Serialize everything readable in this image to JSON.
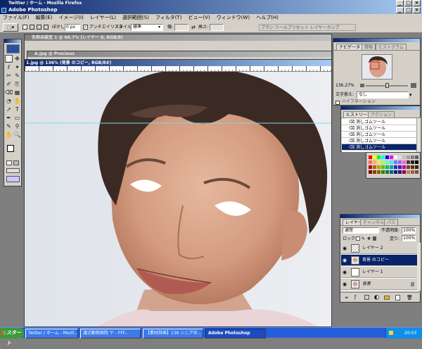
{
  "firefox": {
    "title": "Twitter / ホーム - Mozilla Firefox"
  },
  "photoshop": {
    "title": "Adobe Photoshop",
    "menu": [
      "ファイル(F)",
      "編集(E)",
      "イメージ(I)",
      "レイヤー(L)",
      "選択範囲(S)",
      "フィルタ(T)",
      "ビュー(V)",
      "ウィンドウ(W)",
      "ヘルプ(H)"
    ],
    "options": {
      "feather_label": "ぼかし:",
      "feather_value": "0 px",
      "antialias_label": "アンチエイリアス",
      "style_label": "スタイル:",
      "style_value": "標準",
      "width_label": "幅:",
      "height_label": "高さ:",
      "palette_well": "ブラシ  ツールプリセット  レイヤーカンプ"
    }
  },
  "docs": {
    "back_title": "名称未設定 1 @ 66.7% (レイヤー 0, RGB/8)",
    "mid_title": "A.jpg @ Precious",
    "front_title": "1.jpg @ 136% (背景 のコピー, RGB/8#)"
  },
  "navigator": {
    "tabs": [
      "ナビゲータ",
      "情報",
      "ヒストグラム"
    ],
    "zoom": "136.27%"
  },
  "character": {
    "label": "文字揃え:",
    "value": "なし",
    "checkbox": "ハイフネーション"
  },
  "history": {
    "tabs": [
      "ヒストリー",
      "アクション"
    ],
    "items": [
      "消しゴムツール",
      "消しゴムツール",
      "消しゴムツール",
      "消しゴムツール",
      "消しゴムツール"
    ],
    "selected_index": 4
  },
  "layers": {
    "tabs": [
      "レイヤー",
      "チャンネル",
      "パス"
    ],
    "blend_mode": "通常",
    "opacity_label": "不透明度:",
    "opacity_value": "100%",
    "lock_label": "ロック:",
    "fill_label": "塗り:",
    "fill_value": "100%",
    "rows": [
      {
        "name": "レイヤー 2",
        "selected": false
      },
      {
        "name": "背景 のコピー",
        "selected": true
      },
      {
        "name": "レイヤー 1",
        "selected": false
      },
      {
        "name": "背景",
        "selected": false
      }
    ]
  },
  "taskbar": {
    "start": "スタート",
    "buttons": [
      "Twitter / ホーム - Mozil...",
      "渡辺動物病院 ヤ - FFF...",
      "【素材辞典】136 シニア中...",
      "Adobe Photoshop"
    ],
    "active_index": 3,
    "clock": "20:03"
  },
  "colors": {
    "title_active": "#0a246a",
    "selection": "#0a246a",
    "workspace": "#7f7f7f",
    "panel": "#d4d0c8"
  }
}
